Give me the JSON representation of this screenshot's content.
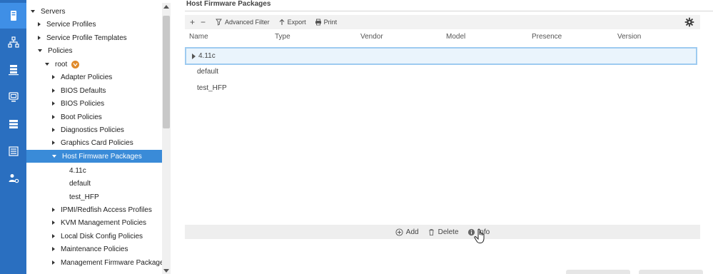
{
  "rail": {
    "items": [
      {
        "icon": "server-icon",
        "active": true
      },
      {
        "icon": "network-icon",
        "active": false
      },
      {
        "icon": "storage-icon",
        "active": false
      },
      {
        "icon": "vm-icon",
        "active": false
      },
      {
        "icon": "chassis-icon",
        "active": false
      },
      {
        "icon": "list-icon",
        "active": false
      },
      {
        "icon": "admin-icon",
        "active": false
      }
    ]
  },
  "tree": {
    "servers": "Servers",
    "service_profiles": "Service Profiles",
    "service_profile_templates": "Service Profile Templates",
    "policies": "Policies",
    "root": "root",
    "adapter_policies": "Adapter Policies",
    "bios_defaults": "BIOS Defaults",
    "bios_policies": "BIOS Policies",
    "boot_policies": "Boot Policies",
    "diagnostics_policies": "Diagnostics Policies",
    "graphics_card_policies": "Graphics Card Policies",
    "host_firmware_packages": "Host Firmware Packages",
    "pkg_4_11c": "4.11c",
    "pkg_default": "default",
    "pkg_test_hfp": "test_HFP",
    "ipmi_profiles": "IPMI/Redfish Access Profiles",
    "kvm_policies": "KVM Management Policies",
    "local_disk_policies": "Local Disk Config Policies",
    "maintenance_policies": "Maintenance Policies",
    "mgmt_firmware_packages": "Management Firmware Packages"
  },
  "panel": {
    "title": "Host Firmware Packages",
    "toolbar": {
      "add": "+",
      "remove": "−",
      "advanced_filter": "Advanced Filter",
      "export": "Export",
      "print": "Print"
    },
    "columns": [
      "Name",
      "Type",
      "Vendor",
      "Model",
      "Presence",
      "Version"
    ],
    "rows": [
      {
        "name": "4.11c",
        "selected": true
      },
      {
        "name": "default",
        "selected": false
      },
      {
        "name": "test_HFP",
        "selected": false
      }
    ],
    "actions": {
      "add": "Add",
      "delete": "Delete",
      "info": "Info"
    }
  },
  "colors": {
    "rail": "#2a6fc0",
    "rail_active": "#3f8fe6",
    "tree_selected": "#3a8bd8",
    "row_selected_bg": "#eaf4fc",
    "row_selected_border": "#9ecbf0",
    "root_badge": "#e08a2a"
  }
}
